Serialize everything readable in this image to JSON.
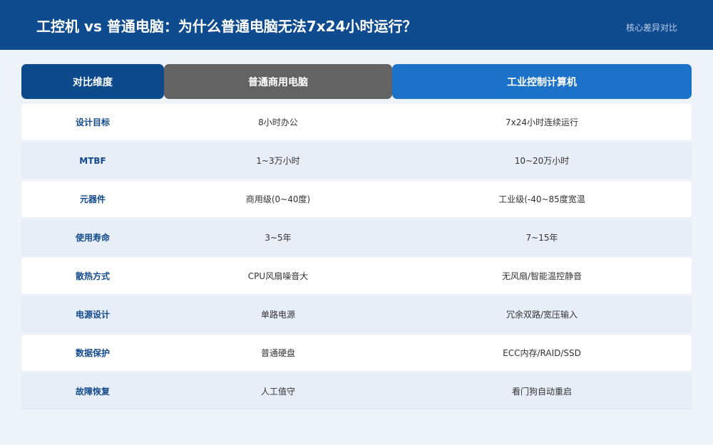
{
  "header": {
    "title": "工控机 vs 普通电脑：为什么普通电脑无法7x24小时运行？",
    "subtitle": "核心差异对比"
  },
  "table": {
    "columns": [
      "对比维度",
      "普通商用电脑",
      "工业控制计算机"
    ],
    "rows": [
      [
        "设计目标",
        "8小时办公",
        "7x24小时连续运行"
      ],
      [
        "MTBF",
        "1~3万小时",
        "10~20万小时"
      ],
      [
        "元器件",
        "商用级(0~40度)",
        "工业级(-40~85度宽温"
      ],
      [
        "使用寿命",
        "3~5年",
        "7~15年"
      ],
      [
        "散热方式",
        "CPU风扇噪音大",
        "无风扇/智能温控静音"
      ],
      [
        "电源设计",
        "单路电源",
        "冗余双路/宽压输入"
      ],
      [
        "数据保护",
        "普通硬盘",
        "ECC内存/RAID/SSD"
      ],
      [
        "故障恢复",
        "人工值守",
        "看门狗自动重启"
      ]
    ]
  },
  "colors": {
    "header_bg": "#0f4c8f",
    "dimension_header": "#0d4a8c",
    "commercial_header": "#636363",
    "industrial_header": "#1c72c8",
    "dimension_text": "#124a8c"
  }
}
